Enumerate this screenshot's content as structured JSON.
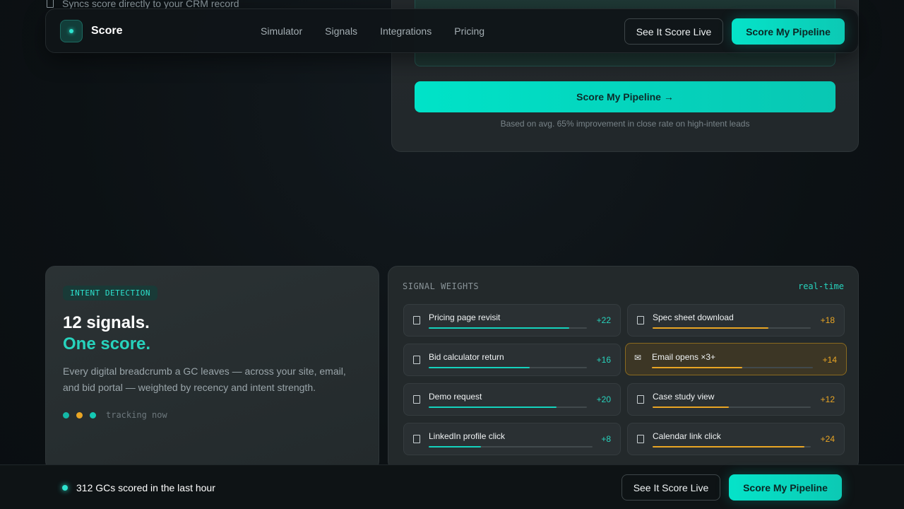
{
  "background": {
    "sync_text": "Syncs score directly to your CRM record",
    "calculator": {
      "cta_label": "Score My Pipeline →",
      "note": "Based on avg. 65% improvement in close rate on high-intent leads"
    }
  },
  "nav": {
    "brand": "Score",
    "links": [
      "Simulator",
      "Signals",
      "Integrations",
      "Pricing"
    ],
    "secondary_cta": "See It Score Live",
    "primary_cta": "Score My Pipeline"
  },
  "intent": {
    "badge": "INTENT DETECTION",
    "heading_line1": "12 signals.",
    "heading_line2": "One score.",
    "description": "Every digital breadcrumb a GC leaves — across your site, email, and bid portal — weighted by recency and intent strength.",
    "tracking_label": "tracking now"
  },
  "weights": {
    "title": "SIGNAL WEIGHTS",
    "status": "real-time",
    "signals": [
      {
        "name": "Pricing page revisit",
        "value": "+22",
        "level": 0.89,
        "color": "#14d2bd",
        "icon": "doc-icon"
      },
      {
        "name": "Spec sheet download",
        "value": "+18",
        "level": 0.73,
        "color": "#e9a524",
        "icon": "doc-icon"
      },
      {
        "name": "Bid calculator return",
        "value": "+16",
        "level": 0.64,
        "color": "#14d2bd",
        "icon": "doc-icon"
      },
      {
        "name": "Email opens ×3+",
        "value": "+14",
        "level": 0.56,
        "color": "#e9a524",
        "icon": "envelope-icon"
      },
      {
        "name": "Demo request",
        "value": "+20",
        "level": 0.81,
        "color": "#14d2bd",
        "icon": "doc-icon"
      },
      {
        "name": "Case study view",
        "value": "+12",
        "level": 0.48,
        "color": "#e9a524",
        "icon": "doc-icon"
      },
      {
        "name": "LinkedIn profile click",
        "value": "+8",
        "level": 0.32,
        "color": "#14d2bd",
        "icon": "doc-icon"
      },
      {
        "name": "Calendar link click",
        "value": "+24",
        "level": 0.96,
        "color": "#e9a524",
        "icon": "doc-icon"
      }
    ]
  },
  "bottom": {
    "live_text": "312 GCs scored in the last hour",
    "secondary_cta": "See It Score Live",
    "primary_cta": "Score My Pipeline"
  },
  "colors": {
    "accent": "#2de3cf",
    "teal_value": "#27d3bd",
    "amber": "#e9a524"
  }
}
